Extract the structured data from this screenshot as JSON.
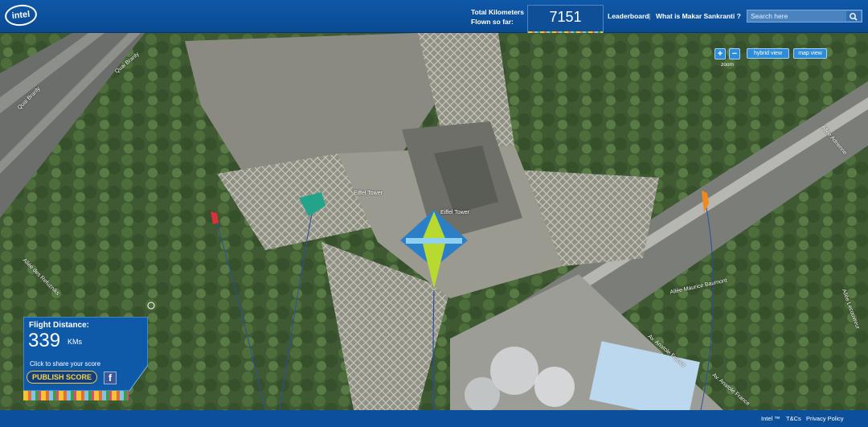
{
  "header": {
    "logo_text": "intel",
    "km_label_line1": "Total Kilometers",
    "km_label_line2": "Flown so far:",
    "km_total": "7151",
    "links": [
      "Leaderboard",
      "What is Makar Sankranti ?"
    ],
    "separator": "|",
    "search_placeholder": "Search here"
  },
  "map": {
    "zoom_in": "+",
    "zoom_out": "−",
    "zoom_label": "zoom",
    "hybrid_view": "hybrid view",
    "map_view": "map view",
    "places": [
      "Quai Branly",
      "Quai Branly",
      "Eiffel Tower",
      "Eiffel Tower",
      "Allée Maurice Baumont",
      "Allée des Refuzniks",
      "Av. Anatole France",
      "Av. Anatole France",
      "Allée Adrienne",
      "Allée Lecouvreur"
    ]
  },
  "score": {
    "label": "Flight Distance:",
    "value": "339",
    "unit": "KMs",
    "share_text": "Click to share your score",
    "publish_label": "PUBLISH SCORE",
    "facebook_icon": "f"
  },
  "footer": {
    "links": [
      "Intel ™",
      "T&Cs",
      "Privacy Policy"
    ]
  },
  "colors": {
    "brand_blue": "#0a4a92",
    "accent_yellow": "#f2c94c",
    "button_blue": "#2f8cd7"
  }
}
